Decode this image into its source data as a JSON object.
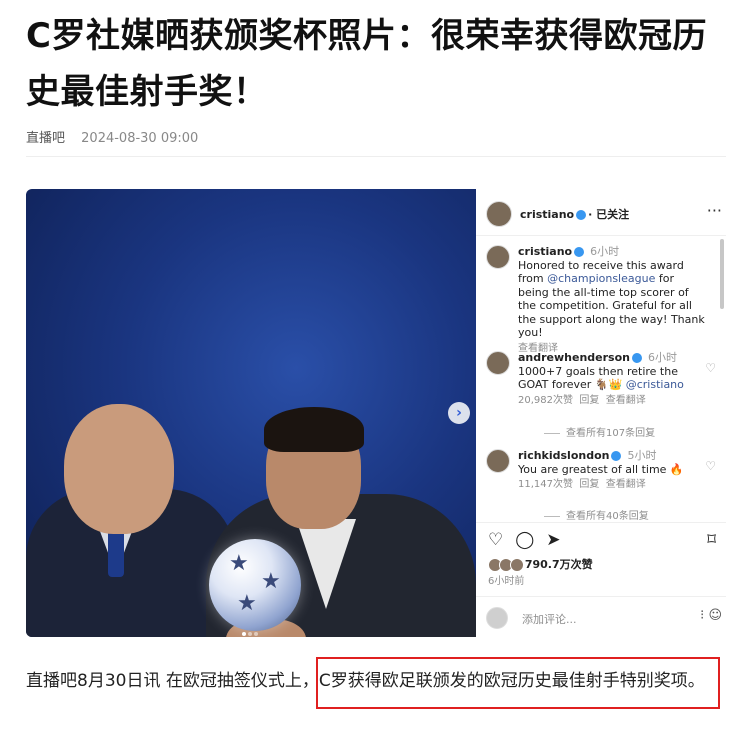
{
  "article": {
    "title": "C罗社媒晒获颁奖杯照片：很荣幸获得欧冠历史最佳射手奖！",
    "source": "直播吧",
    "datetime": "2024-08-30 09:00",
    "paragraph": "直播吧8月30日讯 在欧冠抽签仪式上，C罗获得欧足联颁发的欧冠历史最佳射手特别奖项。"
  },
  "instagram": {
    "username": "cristiano",
    "follow_status": "· 已关注",
    "caption": {
      "user": "cristiano",
      "time": "6小时",
      "text_before_link": "Honored to receive this award from ",
      "link": "@championsleague",
      "text_after_link": " for being the all-time top scorer of the competition. Grateful for all the support along the way! Thank you!",
      "translate": "查看翻译"
    },
    "comments": [
      {
        "user": "andrewhenderson",
        "time": "6小时",
        "text": "1000+7 goals then retire the GOAT forever 🐐👑 ",
        "mention": "@cristiano",
        "likes": "20,982次赞",
        "reply": "回复",
        "translate": "查看翻译",
        "view_replies": "查看所有107条回复"
      },
      {
        "user": "richkidslondon",
        "time": "5小时",
        "text": "You are greatest of all time 🔥",
        "mention": "",
        "likes": "11,147次赞",
        "reply": "回复",
        "translate": "查看翻译",
        "view_replies": "查看所有40条回复"
      }
    ],
    "like_count": "790.7万次赞",
    "time_ago": "6小时前",
    "comment_placeholder": "添加评论..."
  },
  "icons": {
    "heart": "♡",
    "comment": "◯",
    "share": "➤",
    "bookmark": "⌑",
    "more": "···",
    "arrow_next": "›",
    "emoji": "☺"
  },
  "colors": {
    "highlight_border": "#e02020",
    "verified": "#3897f0",
    "link": "#3b5998"
  }
}
